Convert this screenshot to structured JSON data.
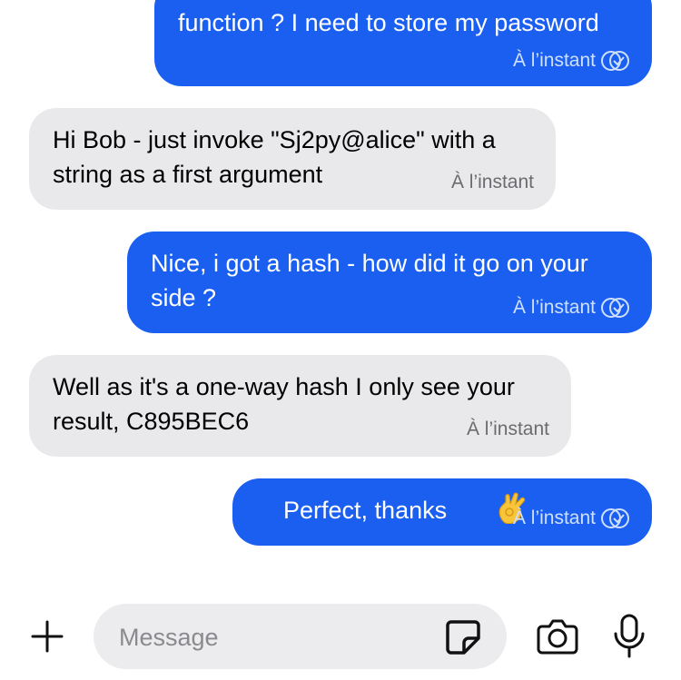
{
  "messages": [
    {
      "text": "function ? I need to store my password",
      "time": "À l’instant",
      "direction": "outgoing",
      "read": true
    },
    {
      "text": "Hi Bob - just invoke \"Sj2py@alice\" with a\nstring as a first argument",
      "time": "À l’instant",
      "direction": "incoming"
    },
    {
      "text": "Nice, i got a hash - how did it go on your\nside ?",
      "time": "À l’instant",
      "direction": "outgoing",
      "read": true
    },
    {
      "text": "Well as it's a one-way hash I only see your\nresult, C895BEC6",
      "time": "À l’instant",
      "direction": "incoming"
    },
    {
      "text": "Perfect, thanks",
      "emoji": "👌",
      "time": "À l’instant",
      "direction": "outgoing",
      "read": true
    }
  ],
  "composer": {
    "placeholder": "Message",
    "icons": [
      "plus-icon",
      "sticker-icon",
      "camera-icon",
      "microphone-icon"
    ]
  },
  "colors": {
    "outgoing_bubble": "#1a5ff0",
    "incoming_bubble": "#e9e9eb",
    "composer_field": "#ececee"
  }
}
